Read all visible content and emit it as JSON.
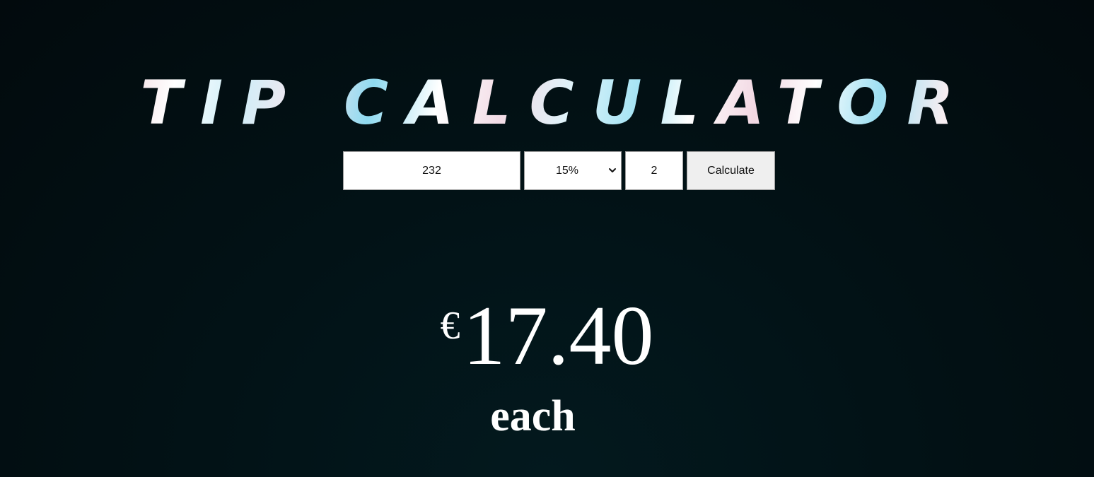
{
  "header": {
    "title": "TIP CALCULATOR"
  },
  "form": {
    "bill_amount": "232",
    "tip_percent_selected": "15%",
    "people_count": "2",
    "calculate_label": "Calculate"
  },
  "result": {
    "currency_symbol": "€",
    "per_person_amount": "17.40",
    "each_label": "each"
  },
  "icons": {
    "select_arrow": "chevron-down-icon"
  },
  "colors": {
    "background_dark": "#020a0d",
    "background_glow": "#03191e",
    "text_primary": "#ffffff",
    "button_bg": "#efefef"
  }
}
